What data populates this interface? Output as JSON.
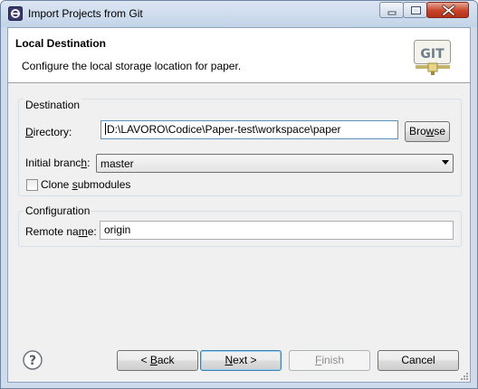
{
  "window": {
    "title": "Import Projects from Git",
    "app_icon": "eclipse-icon",
    "caption_buttons": [
      "minimize-icon",
      "maximize-icon",
      "close-icon"
    ]
  },
  "banner": {
    "title": "Local Destination",
    "description": "Configure the local storage location for paper.",
    "logo_text": "GIT"
  },
  "destination_group": {
    "legend": "Destination",
    "directory_label_underlined": "D",
    "directory_label_rest": "irectory:",
    "directory_value": "D:\\LAVORO\\Codice\\Paper-test\\workspace\\paper",
    "browse_label_pre": "Bro",
    "browse_label_ul": "w",
    "browse_label_post": "se",
    "branch_label_pre": "Initial branc",
    "branch_label_ul": "h",
    "branch_label_post": ":",
    "branch_value": "master",
    "clone_label_pre": "Clone ",
    "clone_label_ul": "s",
    "clone_label_post": "ubmodules",
    "clone_checked": false
  },
  "configuration_group": {
    "legend": "Configuration",
    "remote_label_pre": "Remote na",
    "remote_label_ul": "m",
    "remote_label_post": "e:",
    "remote_value": "origin"
  },
  "footer": {
    "help_icon": "help-icon",
    "back_pre": "< ",
    "back_ul": "B",
    "back_post": "ack",
    "next_ul": "N",
    "next_post": "ext >",
    "finish_ul": "F",
    "finish_post": "inish",
    "cancel_label": "Cancel"
  },
  "colors": {
    "title_bar": "#c3d4e8",
    "client_bg": "#f0f0f0",
    "close_button": "#c7442a",
    "focus_border": "#3c7fb1"
  }
}
